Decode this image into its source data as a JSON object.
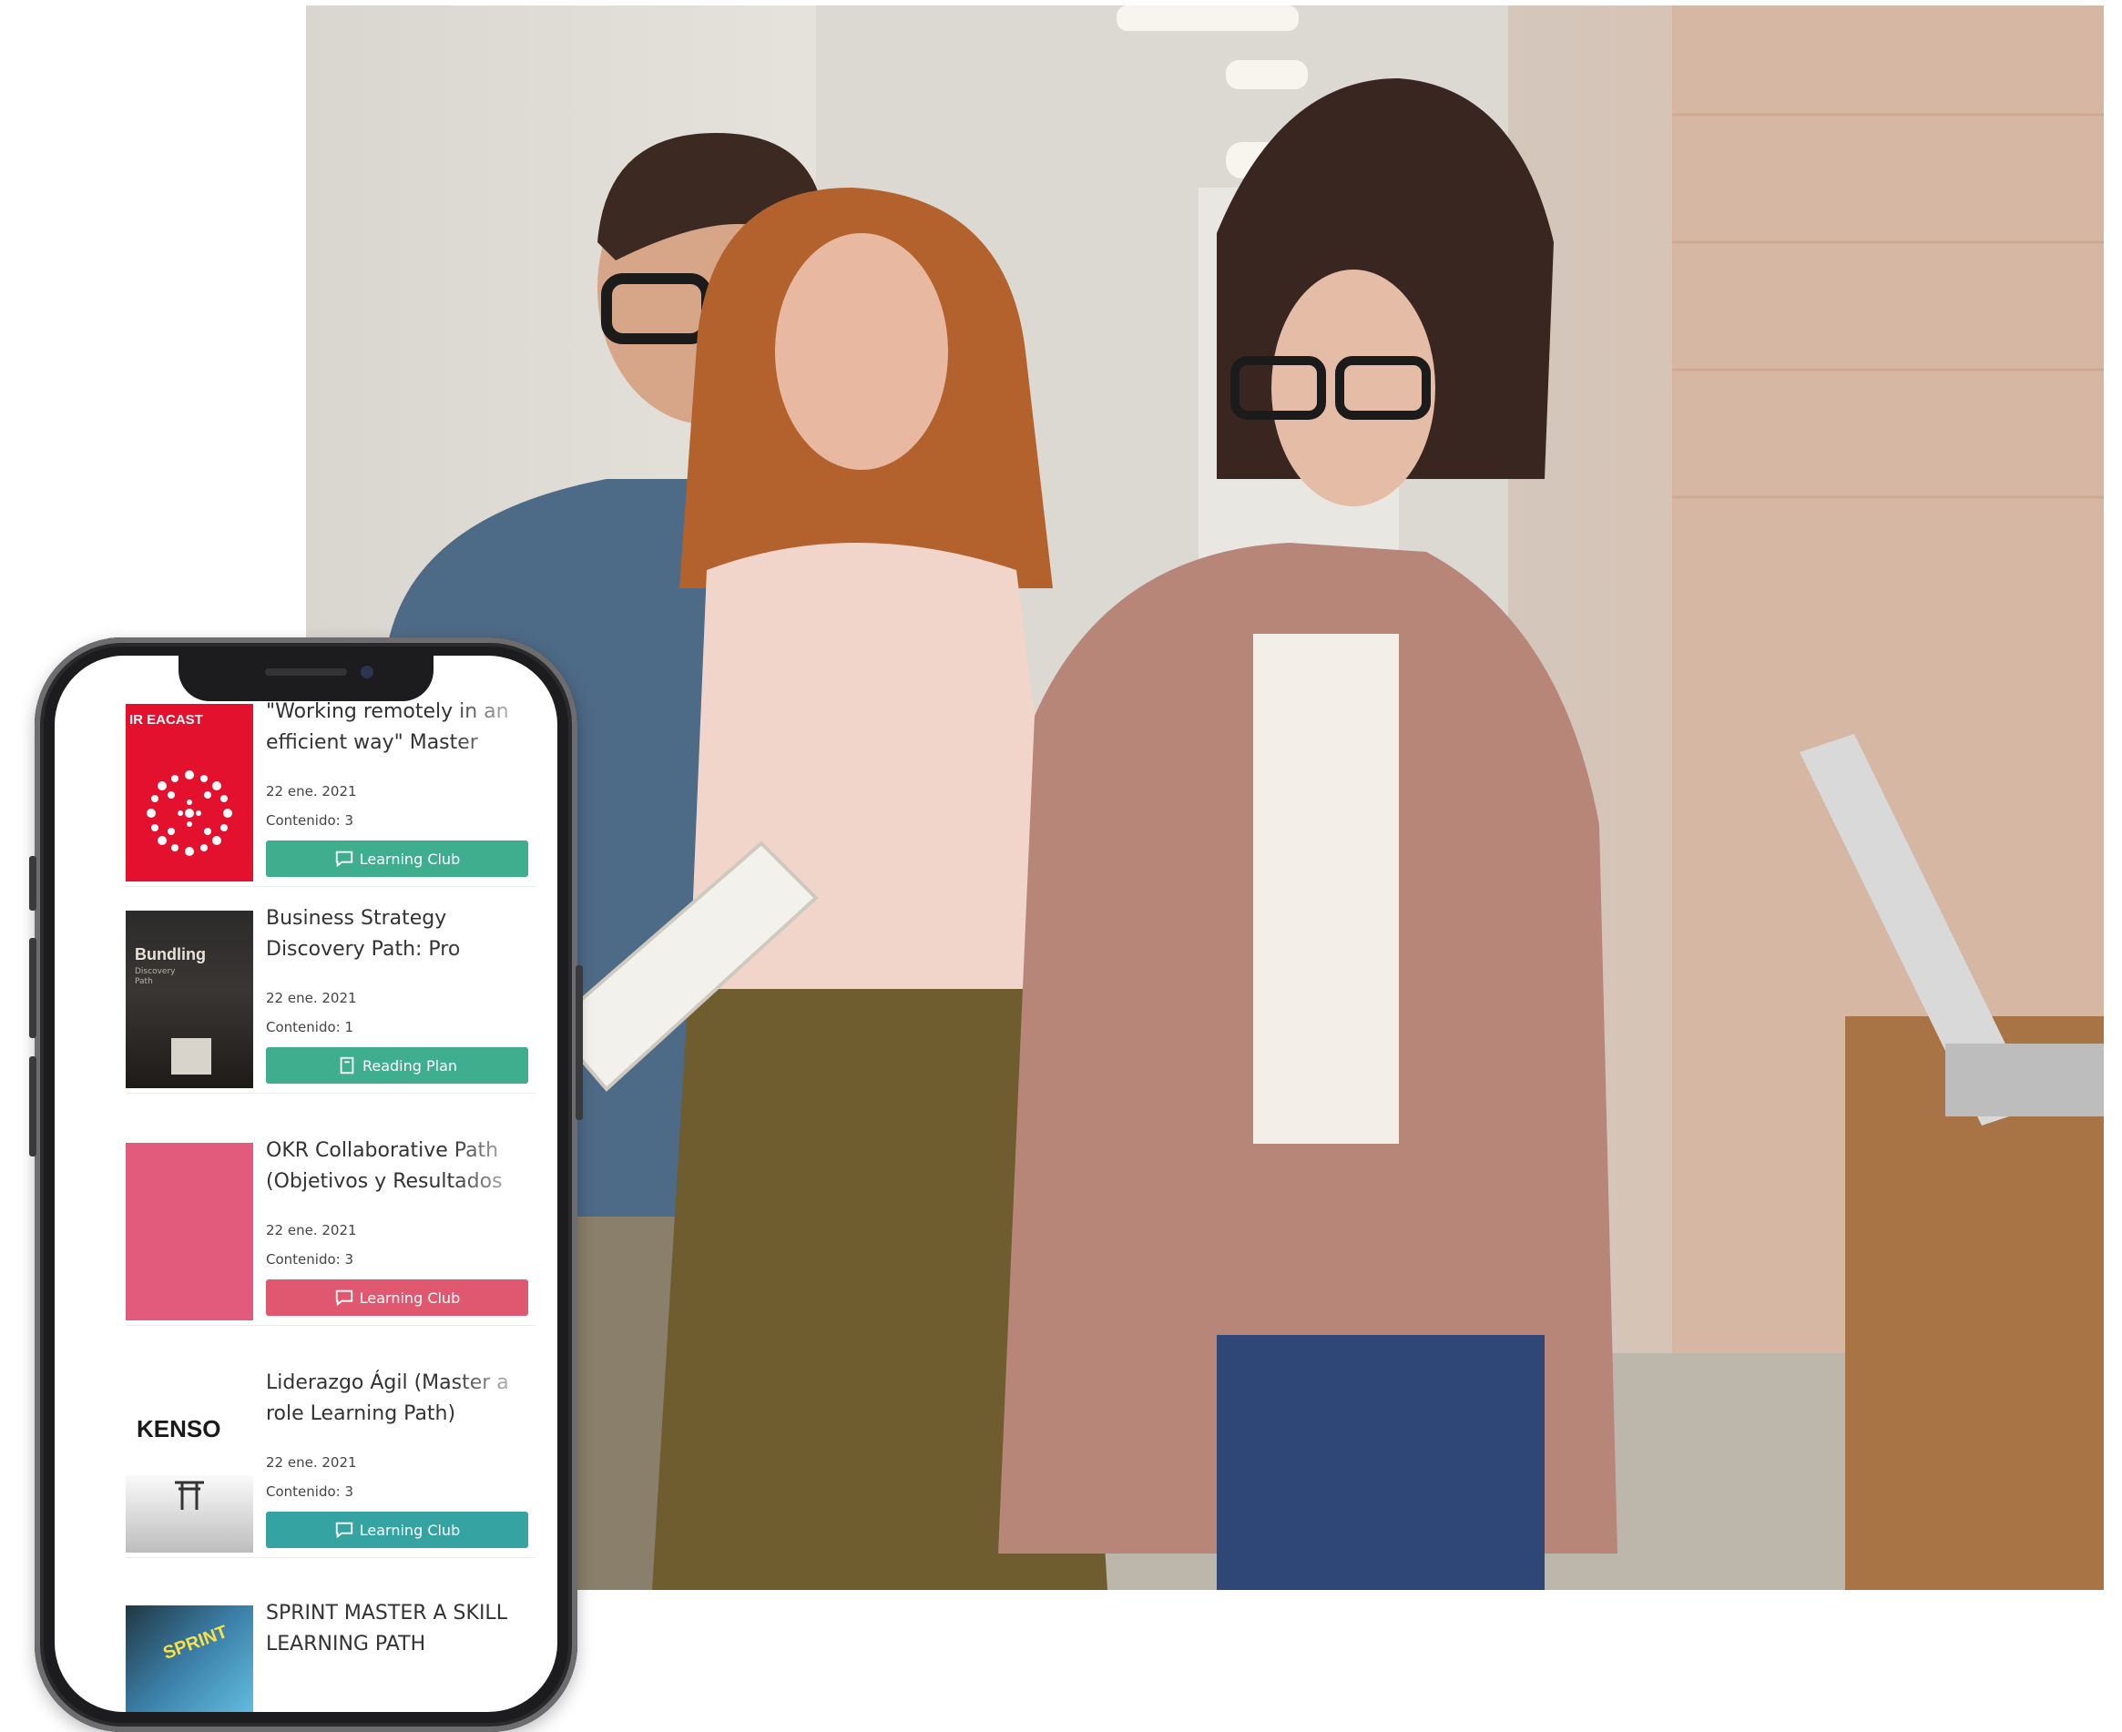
{
  "photo": {
    "description_icon": "team-meeting-photo"
  },
  "phone": {
    "cards": [
      {
        "title": "\"Working remotely in an efficient way\" Master",
        "thumb_text": "IR EACAST",
        "date": "22 ene. 2021",
        "content": "Contenido: 3",
        "tag": "Learning Club",
        "tag_icon": "chat-icon",
        "tag_color": "#3fae8e"
      },
      {
        "title": "Business Strategy Discovery Path: Pro",
        "thumb_text": "Bundling",
        "thumb_subtext": "Discovery Path",
        "date": "22 ene. 2021",
        "content": "Contenido: 1",
        "tag": "Reading Plan",
        "tag_icon": "book-icon",
        "tag_color": "#3fae8e"
      },
      {
        "title": "OKR Collaborative Path (Objetivos y Resultados",
        "date": "22 ene. 2021",
        "content": "Contenido: 3",
        "tag": "Learning Club",
        "tag_icon": "chat-icon",
        "tag_color": "#e0586f"
      },
      {
        "title": "Liderazgo Ágil (Master a role Learning Path)",
        "thumb_text": "KENSO",
        "date": "22 ene. 2021",
        "content": "Contenido: 3",
        "tag": "Learning Club",
        "tag_icon": "chat-icon",
        "tag_color": "#36a3a3"
      },
      {
        "title": "SPRINT MASTER A SKILL LEARNING PATH",
        "thumb_text": "SPRINT"
      }
    ]
  }
}
